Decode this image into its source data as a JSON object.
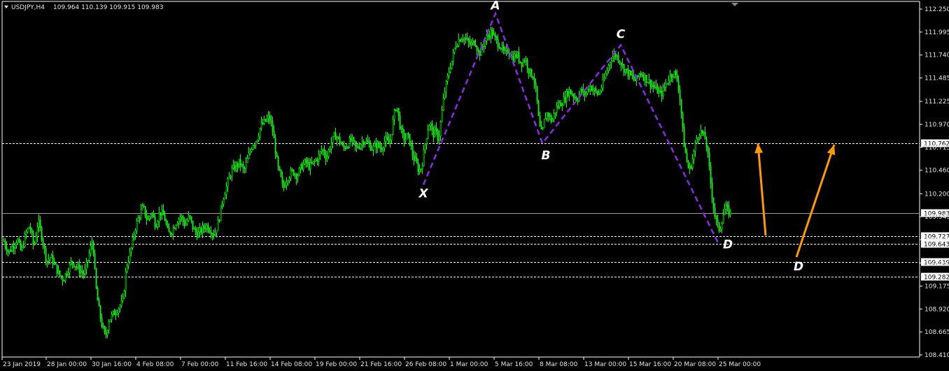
{
  "header": {
    "symbol": "USDJPY,H4",
    "ohlc": "109.964 110.139 109.915 109.983"
  },
  "colors": {
    "background": "#000000",
    "candles": "#00ff00",
    "grid_lines": "#ffffff",
    "pattern": "#8a2be2",
    "arrows": "#ff9900",
    "axis_text": "#e6e6e6",
    "price_box_bg": "#ffffff",
    "price_box_text": "#000000"
  },
  "chart_data": {
    "type": "candlestick",
    "y_range": [
      108.4,
      112.3
    ],
    "y_ticks": [
      "112.250",
      "111.995",
      "111.740",
      "111.485",
      "111.225",
      "110.970",
      "110.715",
      "110.460",
      "110.200",
      "109.945",
      "109.690",
      "109.430",
      "109.175",
      "108.920",
      "108.665",
      "108.410"
    ],
    "x_ticks": [
      "23 Jan 2019",
      "28 Jan 00:00",
      "30 Jan 16:00",
      "4 Feb 08:00",
      "7 Feb 00:00",
      "11 Feb 16:00",
      "14 Feb 08:00",
      "19 Feb 00:00",
      "21 Feb 16:00",
      "26 Feb 08:00",
      "1 Mar 00:00",
      "5 Mar 16:00",
      "8 Mar 08:00",
      "13 Mar 00:00",
      "15 Mar 16:00",
      "20 Mar 08:00",
      "25 Mar 00:00"
    ],
    "price_levels": [
      {
        "label": "110.762",
        "value": 110.762,
        "style": "dashed"
      },
      {
        "label": "109.983",
        "value": 109.983,
        "style": "solid"
      },
      {
        "label": "109.727",
        "value": 109.727,
        "style": "dashed"
      },
      {
        "label": "109.643",
        "value": 109.643,
        "style": "dashed"
      },
      {
        "label": "109.439",
        "value": 109.439,
        "style": "dashed"
      },
      {
        "label": "109.282",
        "value": 109.282,
        "style": "dashed"
      }
    ],
    "close_path": [
      [
        0,
        109.8
      ],
      [
        6,
        109.65
      ],
      [
        12,
        109.55
      ],
      [
        18,
        109.62
      ],
      [
        24,
        109.7
      ],
      [
        30,
        109.55
      ],
      [
        36,
        109.75
      ],
      [
        42,
        109.85
      ],
      [
        48,
        109.6
      ],
      [
        54,
        109.9
      ],
      [
        60,
        109.7
      ],
      [
        66,
        109.45
      ],
      [
        72,
        109.5
      ],
      [
        78,
        109.4
      ],
      [
        84,
        109.3
      ],
      [
        90,
        109.25
      ],
      [
        96,
        109.35
      ],
      [
        102,
        109.45
      ],
      [
        108,
        109.4
      ],
      [
        114,
        109.35
      ],
      [
        120,
        109.3
      ],
      [
        126,
        109.5
      ],
      [
        132,
        109.7
      ],
      [
        136,
        109.2
      ],
      [
        140,
        108.95
      ],
      [
        145,
        108.75
      ],
      [
        150,
        108.6
      ],
      [
        155,
        108.8
      ],
      [
        160,
        108.85
      ],
      [
        165,
        108.9
      ],
      [
        170,
        108.95
      ],
      [
        175,
        109.0
      ],
      [
        180,
        109.4
      ],
      [
        186,
        109.55
      ],
      [
        192,
        109.8
      ],
      [
        198,
        109.95
      ],
      [
        204,
        110.05
      ],
      [
        210,
        109.9
      ],
      [
        216,
        110.0
      ],
      [
        222,
        109.85
      ],
      [
        228,
        110.0
      ],
      [
        234,
        109.95
      ],
      [
        240,
        109.75
      ],
      [
        246,
        109.8
      ],
      [
        252,
        109.9
      ],
      [
        258,
        109.95
      ],
      [
        264,
        109.85
      ],
      [
        270,
        109.95
      ],
      [
        276,
        109.8
      ],
      [
        282,
        109.75
      ],
      [
        288,
        109.8
      ],
      [
        294,
        109.85
      ],
      [
        300,
        109.8
      ],
      [
        306,
        109.75
      ],
      [
        312,
        109.9
      ],
      [
        318,
        110.15
      ],
      [
        324,
        110.3
      ],
      [
        330,
        110.45
      ],
      [
        336,
        110.5
      ],
      [
        342,
        110.55
      ],
      [
        348,
        110.45
      ],
      [
        354,
        110.6
      ],
      [
        360,
        110.75
      ],
      [
        366,
        110.8
      ],
      [
        372,
        110.95
      ],
      [
        378,
        111.0
      ],
      [
        384,
        111.05
      ],
      [
        388,
        110.95
      ],
      [
        392,
        110.75
      ],
      [
        396,
        110.5
      ],
      [
        400,
        110.4
      ],
      [
        404,
        110.25
      ],
      [
        408,
        110.35
      ],
      [
        412,
        110.4
      ],
      [
        418,
        110.45
      ],
      [
        424,
        110.4
      ],
      [
        430,
        110.5
      ],
      [
        436,
        110.55
      ],
      [
        442,
        110.5
      ],
      [
        448,
        110.55
      ],
      [
        454,
        110.6
      ],
      [
        460,
        110.7
      ],
      [
        466,
        110.6
      ],
      [
        472,
        110.75
      ],
      [
        478,
        110.85
      ],
      [
        484,
        110.8
      ],
      [
        490,
        110.7
      ],
      [
        496,
        110.75
      ],
      [
        502,
        110.8
      ],
      [
        508,
        110.7
      ],
      [
        514,
        110.75
      ],
      [
        520,
        110.8
      ],
      [
        526,
        110.75
      ],
      [
        532,
        110.7
      ],
      [
        538,
        110.75
      ],
      [
        544,
        110.7
      ],
      [
        550,
        110.8
      ],
      [
        556,
        110.75
      ],
      [
        562,
        111.05
      ],
      [
        566,
        111.2
      ],
      [
        570,
        111.0
      ],
      [
        574,
        110.85
      ],
      [
        578,
        110.8
      ],
      [
        582,
        110.85
      ],
      [
        586,
        110.75
      ],
      [
        590,
        110.6
      ],
      [
        594,
        110.55
      ],
      [
        598,
        110.45
      ],
      [
        602,
        110.5
      ],
      [
        606,
        110.7
      ],
      [
        610,
        110.9
      ],
      [
        614,
        111.0
      ],
      [
        618,
        110.85
      ],
      [
        622,
        110.9
      ],
      [
        626,
        110.8
      ],
      [
        630,
        111.05
      ],
      [
        634,
        111.3
      ],
      [
        638,
        111.45
      ],
      [
        642,
        111.6
      ],
      [
        646,
        111.7
      ],
      [
        650,
        111.85
      ],
      [
        654,
        111.9
      ],
      [
        660,
        111.95
      ],
      [
        666,
        111.9
      ],
      [
        672,
        111.85
      ],
      [
        678,
        111.9
      ],
      [
        684,
        111.75
      ],
      [
        690,
        111.85
      ],
      [
        696,
        111.95
      ],
      [
        702,
        112.0
      ],
      [
        708,
        111.9
      ],
      [
        714,
        111.85
      ],
      [
        720,
        111.75
      ],
      [
        726,
        111.8
      ],
      [
        732,
        111.7
      ],
      [
        738,
        111.75
      ],
      [
        744,
        111.65
      ],
      [
        750,
        111.7
      ],
      [
        756,
        111.55
      ],
      [
        762,
        111.5
      ],
      [
        766,
        111.3
      ],
      [
        770,
        110.95
      ],
      [
        774,
        110.85
      ],
      [
        778,
        111.05
      ],
      [
        782,
        111.1
      ],
      [
        788,
        111.0
      ],
      [
        794,
        111.15
      ],
      [
        800,
        111.2
      ],
      [
        806,
        111.25
      ],
      [
        812,
        111.35
      ],
      [
        818,
        111.3
      ],
      [
        824,
        111.25
      ],
      [
        830,
        111.35
      ],
      [
        836,
        111.3
      ],
      [
        842,
        111.4
      ],
      [
        848,
        111.35
      ],
      [
        854,
        111.3
      ],
      [
        860,
        111.4
      ],
      [
        866,
        111.55
      ],
      [
        872,
        111.7
      ],
      [
        878,
        111.75
      ],
      [
        884,
        111.7
      ],
      [
        890,
        111.6
      ],
      [
        896,
        111.55
      ],
      [
        902,
        111.5
      ],
      [
        908,
        111.45
      ],
      [
        914,
        111.55
      ],
      [
        920,
        111.5
      ],
      [
        926,
        111.45
      ],
      [
        932,
        111.4
      ],
      [
        938,
        111.35
      ],
      [
        944,
        111.3
      ],
      [
        950,
        111.4
      ],
      [
        956,
        111.5
      ],
      [
        962,
        111.55
      ],
      [
        968,
        111.45
      ],
      [
        972,
        111.2
      ],
      [
        976,
        110.8
      ],
      [
        980,
        110.6
      ],
      [
        984,
        110.45
      ],
      [
        988,
        110.55
      ],
      [
        992,
        110.7
      ],
      [
        996,
        110.85
      ],
      [
        1000,
        110.9
      ],
      [
        1004,
        110.85
      ],
      [
        1008,
        110.8
      ],
      [
        1012,
        110.55
      ],
      [
        1016,
        110.25
      ],
      [
        1020,
        110.0
      ],
      [
        1024,
        109.85
      ],
      [
        1028,
        109.8
      ],
      [
        1032,
        109.95
      ],
      [
        1036,
        110.05
      ],
      [
        1040,
        110.0
      ],
      [
        1044,
        109.98
      ]
    ],
    "pattern": [
      {
        "label": "X",
        "x": 605,
        "value": 110.3
      },
      {
        "label": "A",
        "x": 708,
        "value": 112.2
      },
      {
        "label": "B",
        "x": 775,
        "value": 110.76
      },
      {
        "label": "C",
        "x": 887,
        "value": 111.85
      },
      {
        "label": "D",
        "x": 1027,
        "value": 109.64
      }
    ],
    "projection_labels": [
      "D"
    ]
  }
}
